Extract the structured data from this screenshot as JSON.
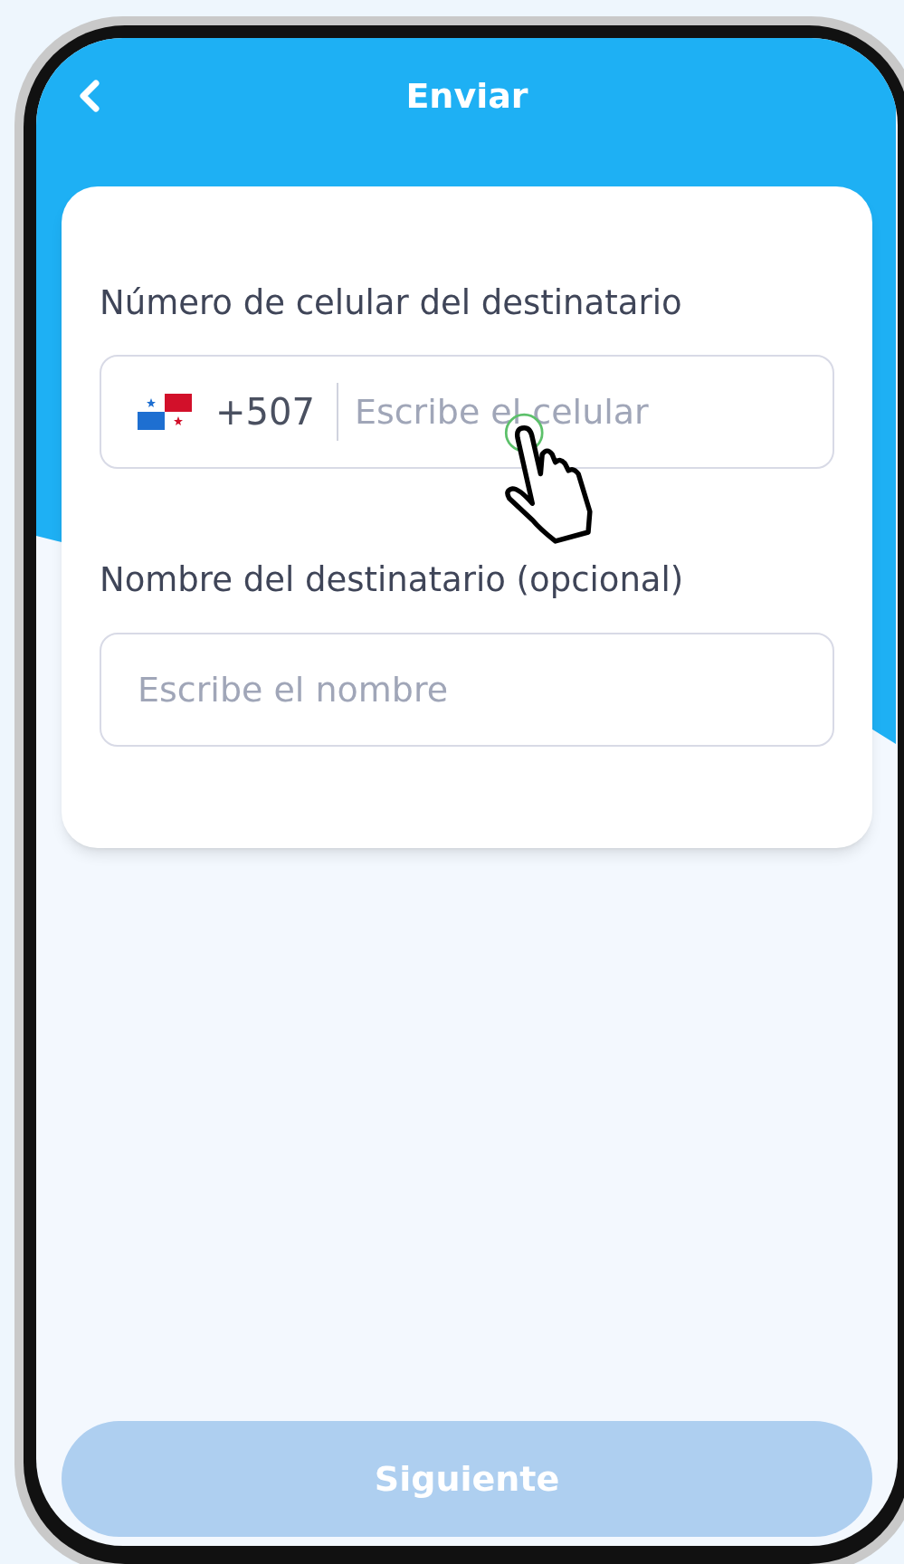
{
  "header": {
    "title": "Enviar"
  },
  "fields": [
    {
      "kind": "phone",
      "label": "Número de celular del destinatario",
      "country_code": "+507",
      "placeholder": "Escribe el celular"
    },
    {
      "kind": "text",
      "label": "Nombre del destinatario (opcional)",
      "placeholder": "Escribe el nombre"
    }
  ],
  "next_button": {
    "label": "Siguiente",
    "disabled": true
  }
}
